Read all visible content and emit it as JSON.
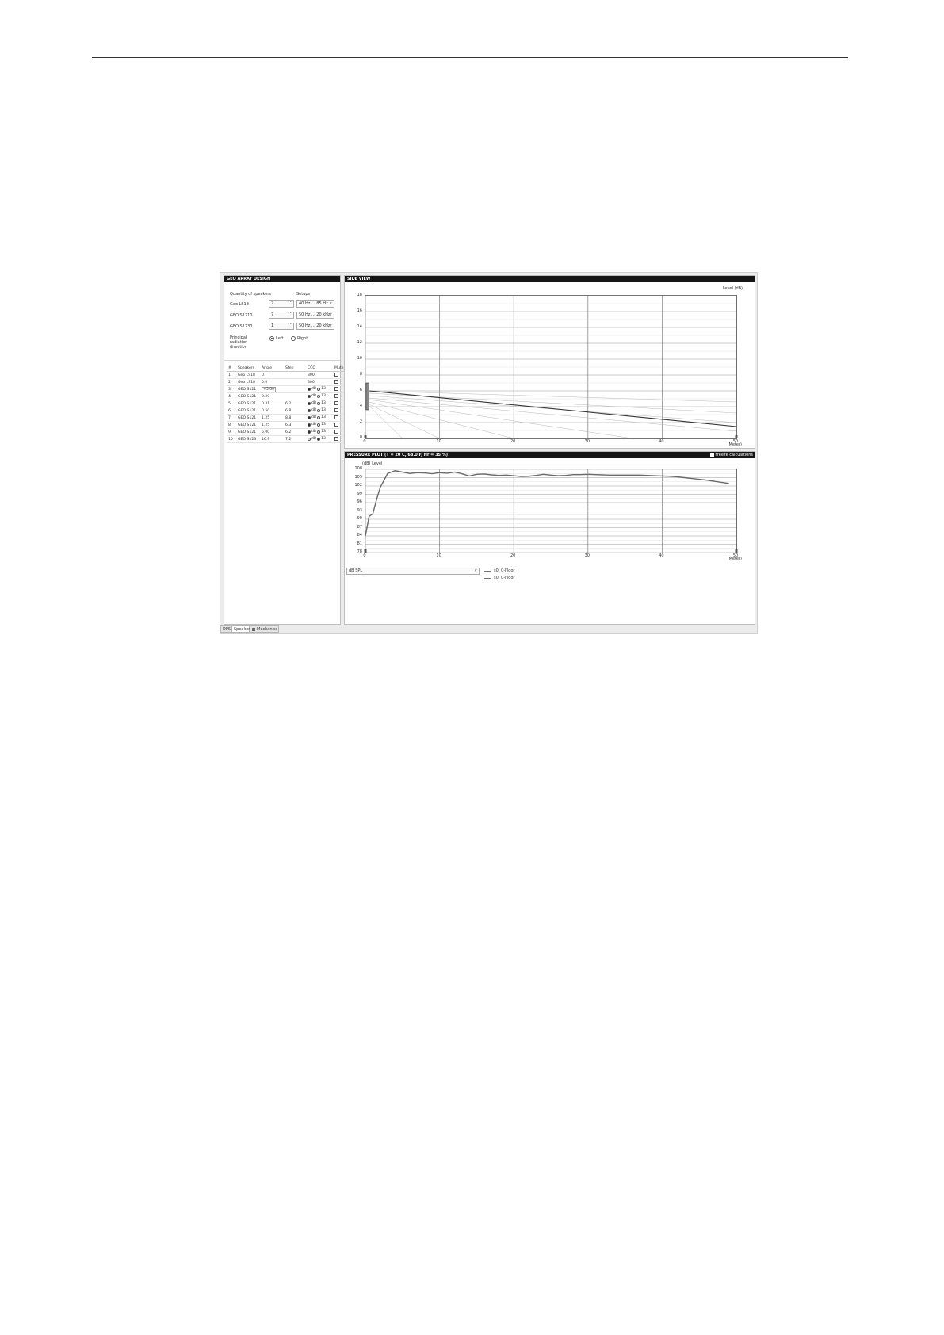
{
  "left_panel": {
    "title": "GEO ARRAY DESIGN",
    "quantity_label": "Quantity of speakers",
    "setups_label": "Setups",
    "speakers": [
      {
        "name": "Geo LS18",
        "qty": "2",
        "range": "40 Hz ... 85 Hz"
      },
      {
        "name": "GEO S1210",
        "qty": "7",
        "range": "50 Hz ... 20 kHz"
      },
      {
        "name": "GEO S1230",
        "qty": "1",
        "range": "50 Hz ... 20 kHz"
      }
    ],
    "principal_label_1": "Principal",
    "principal_label_2": "radiation",
    "principal_label_3": "direction",
    "radio_left": "Left",
    "radio_right": "Right",
    "selected_direction": "left"
  },
  "table": {
    "headers": [
      "#",
      "Speakers",
      "Angle",
      "Step",
      "CCO",
      "Mute"
    ],
    "rows": [
      {
        "num": "1",
        "speaker": "Geo LS18",
        "angle": "0",
        "step": "",
        "cco": "300",
        "cco_type": "text",
        "mute": true
      },
      {
        "num": "2",
        "speaker": "Geo LS18",
        "angle": "0.0",
        "step": "",
        "cco": "300",
        "cco_type": "text",
        "mute": true
      },
      {
        "num": "3",
        "speaker": "GEO S121",
        "angle": "+5.00",
        "step": "",
        "cco": "",
        "cco_type": "radio",
        "cco_sel": "dB",
        "mute": true
      },
      {
        "num": "4",
        "speaker": "GEO S121",
        "angle": "0.20",
        "step": "",
        "cco": "",
        "cco_type": "radio",
        "cco_sel": "dB",
        "mute": true
      },
      {
        "num": "5",
        "speaker": "GEO S121",
        "angle": "0.31",
        "step": "6.2",
        "cco": "",
        "cco_type": "radio",
        "cco_sel": "dB",
        "mute": true
      },
      {
        "num": "6",
        "speaker": "GEO S121",
        "angle": "0.50",
        "step": "6.8",
        "cco": "",
        "cco_type": "radio",
        "cco_sel": "dB",
        "mute": true
      },
      {
        "num": "7",
        "speaker": "GEO S121",
        "angle": "1.25",
        "step": "8.8",
        "cco": "",
        "cco_type": "radio",
        "cco_sel": "dB",
        "mute": true
      },
      {
        "num": "8",
        "speaker": "GEO S121",
        "angle": "1.25",
        "step": "6.3",
        "cco": "",
        "cco_type": "radio",
        "cco_sel": "dB",
        "mute": true
      },
      {
        "num": "9",
        "speaker": "GEO S121",
        "angle": "5.00",
        "step": "6.2",
        "cco": "",
        "cco_type": "radio",
        "cco_sel": "dB",
        "mute": true
      },
      {
        "num": "10",
        "speaker": "GEO S123",
        "angle": "16.9",
        "step": "7.2",
        "cco": "",
        "cco_type": "radio",
        "cco_sel": "13",
        "mute": true
      }
    ],
    "cco_opt_a": "dB",
    "cco_opt_b": "13"
  },
  "side_view": {
    "title": "SIDE VIEW",
    "level_label": "Level  (dB)",
    "x_unit": "(Meter)"
  },
  "pressure_plot": {
    "title": "PRESSURE PLOT  (T = 20 C, 68.0 F, Hr = 35 %)",
    "freeze_label": "Freeze calculations",
    "y_label": "(dB)  Level",
    "x_unit": "(Meter)",
    "dropdown_value": "dB SPL",
    "legend": [
      "s0: 0-Floor",
      "s0: 0-Floor"
    ]
  },
  "tabs": [
    "DPS",
    "Speaker",
    "Mechanics"
  ],
  "active_tab": 1,
  "chart_data": [
    {
      "type": "line",
      "title": "SIDE VIEW",
      "ylabel": "Level  (dB)",
      "xlabel": "(Meter)",
      "xlim": [
        0,
        50
      ],
      "ylim": [
        0,
        18
      ],
      "xticks": [
        "0",
        "10",
        "20",
        "30",
        "40",
        "50"
      ],
      "yticks": [
        "0",
        "2",
        "4",
        "6",
        "8",
        "10",
        "12",
        "14",
        "16",
        "18"
      ],
      "grid": true,
      "array_position": {
        "x": 0.2,
        "y_top": 7.0,
        "y_bottom": 3.6
      },
      "main_ray": {
        "x": [
          0.5,
          50
        ],
        "y": [
          6.0,
          1.5
        ]
      },
      "fan_rays": [
        {
          "x": [
            0.5,
            50
          ],
          "y": [
            6.0,
            4.6
          ]
        },
        {
          "x": [
            0.5,
            50
          ],
          "y": [
            5.7,
            3.2
          ]
        },
        {
          "x": [
            0.5,
            50
          ],
          "y": [
            5.4,
            2.0
          ]
        },
        {
          "x": [
            0.5,
            50
          ],
          "y": [
            5.1,
            0.9
          ]
        },
        {
          "x": [
            0.5,
            36
          ],
          "y": [
            4.9,
            0
          ]
        },
        {
          "x": [
            0.5,
            20
          ],
          "y": [
            4.6,
            0
          ]
        },
        {
          "x": [
            0.5,
            10
          ],
          "y": [
            4.3,
            0
          ]
        },
        {
          "x": [
            0.5,
            5
          ],
          "y": [
            4.1,
            0
          ]
        }
      ]
    },
    {
      "type": "line",
      "title": "PRESSURE PLOT  (T = 20 C, 68.0 F, Hr = 35 %)",
      "ylabel": "(dB)  Level",
      "xlabel": "(Meter)",
      "xlim": [
        0,
        50
      ],
      "ylim": [
        78,
        108
      ],
      "xticks": [
        "0",
        "10",
        "20",
        "30",
        "40",
        "50"
      ],
      "yticks": [
        "78",
        "81",
        "84",
        "87",
        "90",
        "93",
        "96",
        "99",
        "102",
        "105",
        "108"
      ],
      "grid": true,
      "series": [
        {
          "name": "s0: 0-Floor",
          "x": [
            0,
            0.5,
            1,
            1.5,
            2,
            3,
            4,
            5,
            6,
            7,
            8,
            9,
            10,
            11,
            12,
            13,
            14,
            15,
            16,
            17,
            18,
            19,
            20,
            21,
            22,
            23,
            24,
            25,
            26,
            27,
            28,
            29,
            30,
            31,
            32,
            33,
            34,
            35,
            36,
            37,
            38,
            39,
            40,
            41,
            42,
            43,
            44,
            45,
            46,
            47,
            48,
            49
          ],
          "y": [
            84,
            91,
            92,
            97,
            101.5,
            106.5,
            107.5,
            107,
            106.5,
            106.8,
            106.7,
            106.4,
            106.8,
            106.6,
            107,
            106.4,
            105.6,
            106.2,
            106.3,
            106,
            105.8,
            105.9,
            105.7,
            105.4,
            105.5,
            105.8,
            106.2,
            105.9,
            105.7,
            105.8,
            106.1,
            106.1,
            106.2,
            106.1,
            106.0,
            105.9,
            105.9,
            105.9,
            105.9,
            105.9,
            105.8,
            105.7,
            105.6,
            105.5,
            105.3,
            105.0,
            104.7,
            104.4,
            104.1,
            103.7,
            103.3,
            102.9
          ]
        }
      ]
    }
  ]
}
